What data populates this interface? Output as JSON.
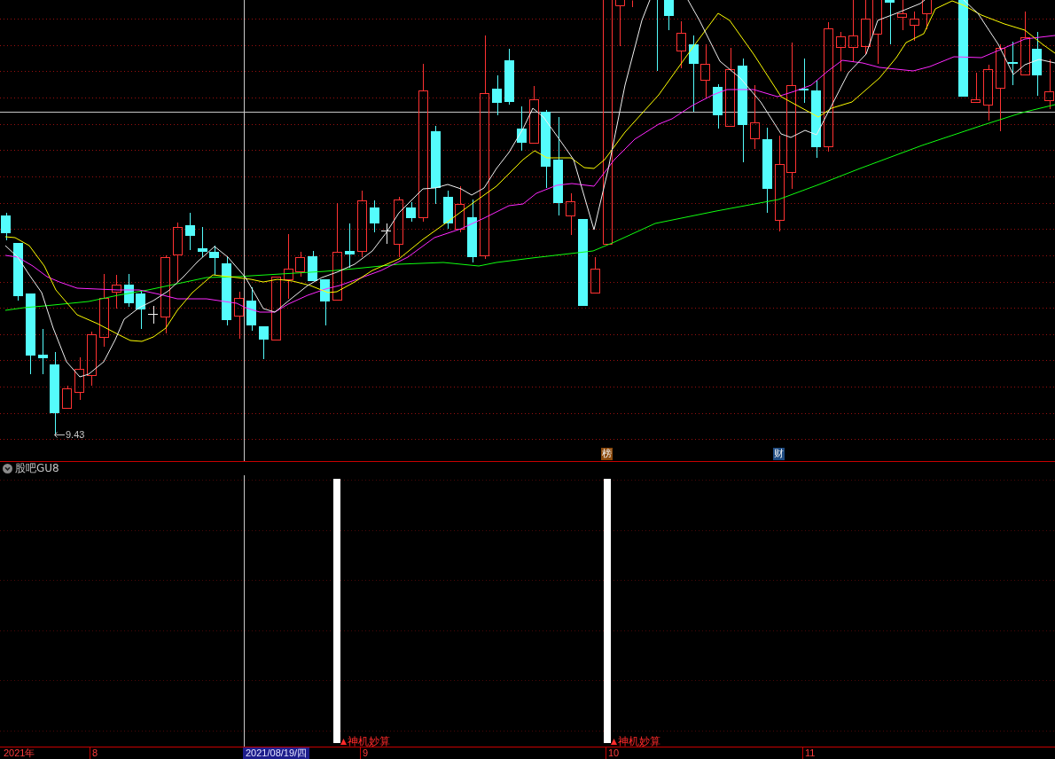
{
  "price_chart": {
    "low_label": "9.43",
    "event_markers": [
      {
        "text": "榜",
        "color": "#8c4a0c"
      },
      {
        "text": "财",
        "color": "#1e4b82"
      }
    ]
  },
  "indicator_panel": {
    "title": "股吧GU8",
    "signals": [
      {
        "label": "神机妙算"
      },
      {
        "label": "神机妙算"
      }
    ]
  },
  "time_axis": {
    "labels": [
      "2021年",
      "8",
      "9",
      "10",
      "11"
    ],
    "cursor_date": "2021/08/19/四"
  }
}
